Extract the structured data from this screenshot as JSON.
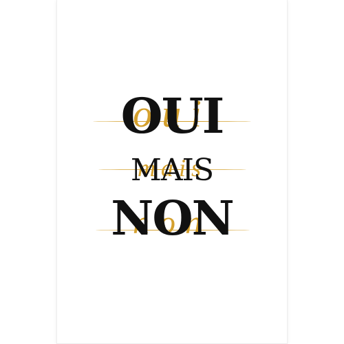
{
  "poster": {
    "lines": [
      {
        "bold": "OUI",
        "script": "oui"
      },
      {
        "bold": "MAIS",
        "script": "mais"
      },
      {
        "bold": "NON",
        "script": "non"
      }
    ]
  },
  "colors": {
    "ink": "#111111",
    "gold": "#d4a02d",
    "paper": "#ffffff"
  }
}
